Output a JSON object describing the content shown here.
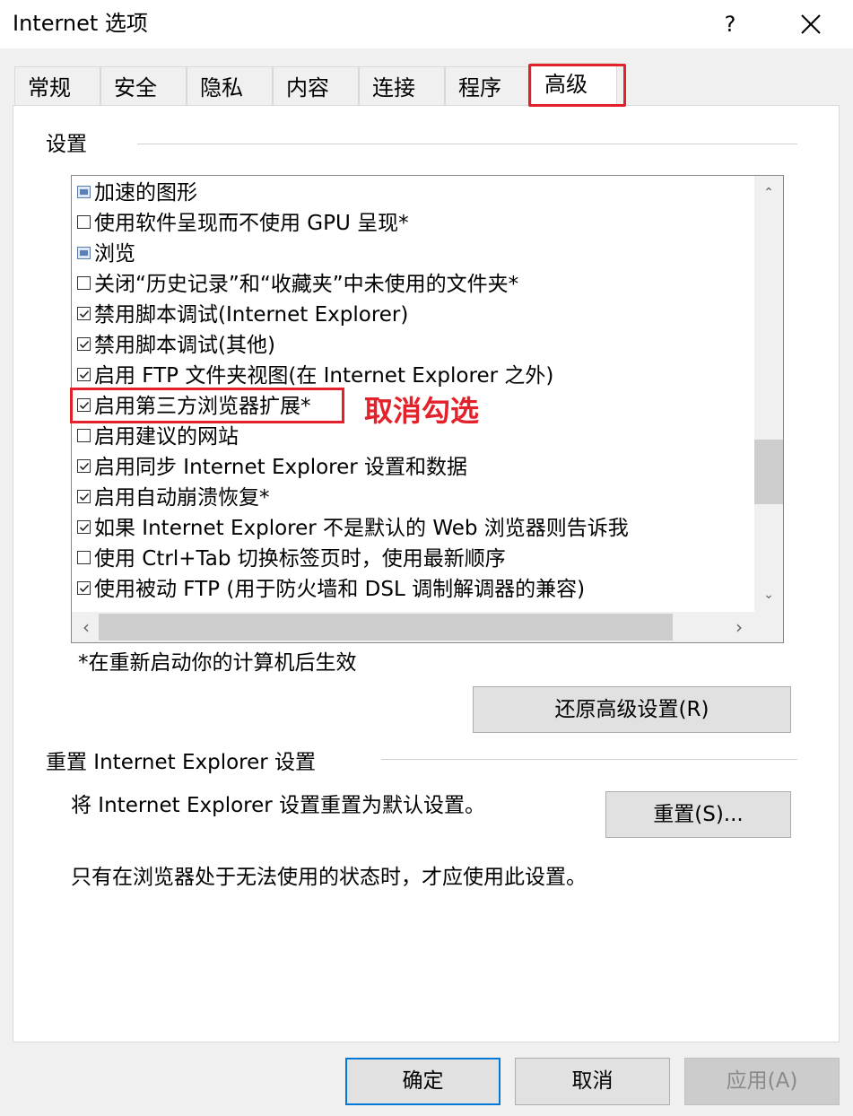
{
  "window": {
    "title": "Internet 选项",
    "help_label": "?",
    "close_icon": "close-icon"
  },
  "tabs": [
    {
      "label": "常规",
      "active": false
    },
    {
      "label": "安全",
      "active": false
    },
    {
      "label": "隐私",
      "active": false
    },
    {
      "label": "内容",
      "active": false
    },
    {
      "label": "连接",
      "active": false
    },
    {
      "label": "程序",
      "active": false
    },
    {
      "label": "高级",
      "active": true
    }
  ],
  "settings": {
    "group_label": "设置",
    "items": [
      {
        "type": "category",
        "label": "加速的图形"
      },
      {
        "type": "checkbox",
        "checked": false,
        "label": "使用软件呈现而不使用 GPU 呈现*"
      },
      {
        "type": "category",
        "label": "浏览"
      },
      {
        "type": "checkbox",
        "checked": false,
        "label": "关闭“历史记录”和“收藏夹”中未使用的文件夹*"
      },
      {
        "type": "checkbox",
        "checked": true,
        "label": "禁用脚本调试(Internet Explorer)"
      },
      {
        "type": "checkbox",
        "checked": true,
        "label": "禁用脚本调试(其他)"
      },
      {
        "type": "checkbox",
        "checked": true,
        "label": "启用 FTP 文件夹视图(在 Internet Explorer 之外)"
      },
      {
        "type": "checkbox",
        "checked": true,
        "label": "启用第三方浏览器扩展*"
      },
      {
        "type": "checkbox",
        "checked": false,
        "label": "启用建议的网站"
      },
      {
        "type": "checkbox",
        "checked": true,
        "label": "启用同步 Internet Explorer 设置和数据"
      },
      {
        "type": "checkbox",
        "checked": true,
        "label": "启用自动崩溃恢复*"
      },
      {
        "type": "checkbox",
        "checked": true,
        "label": "如果 Internet Explorer 不是默认的 Web 浏览器则告诉我"
      },
      {
        "type": "checkbox",
        "checked": false,
        "label": "使用 Ctrl+Tab 切换标签页时，使用最新顺序"
      },
      {
        "type": "checkbox",
        "checked": true,
        "label": "使用被动 FTP (用于防火墙和 DSL 调制解调器的兼容)"
      }
    ],
    "annotation": "取消勾选",
    "restart_note": "*在重新启动你的计算机后生效",
    "restore_button": "还原高级设置(R)"
  },
  "reset": {
    "group_label": "重置 Internet Explorer 设置",
    "description": "将 Internet Explorer 设置重置为默认设置。",
    "button": "重置(S)...",
    "warning": "只有在浏览器处于无法使用的状态时，才应使用此设置。"
  },
  "footer": {
    "ok": "确定",
    "cancel": "取消",
    "apply": "应用(A)"
  },
  "colors": {
    "highlight": "#e3212a",
    "focus_border": "#0078d7"
  }
}
